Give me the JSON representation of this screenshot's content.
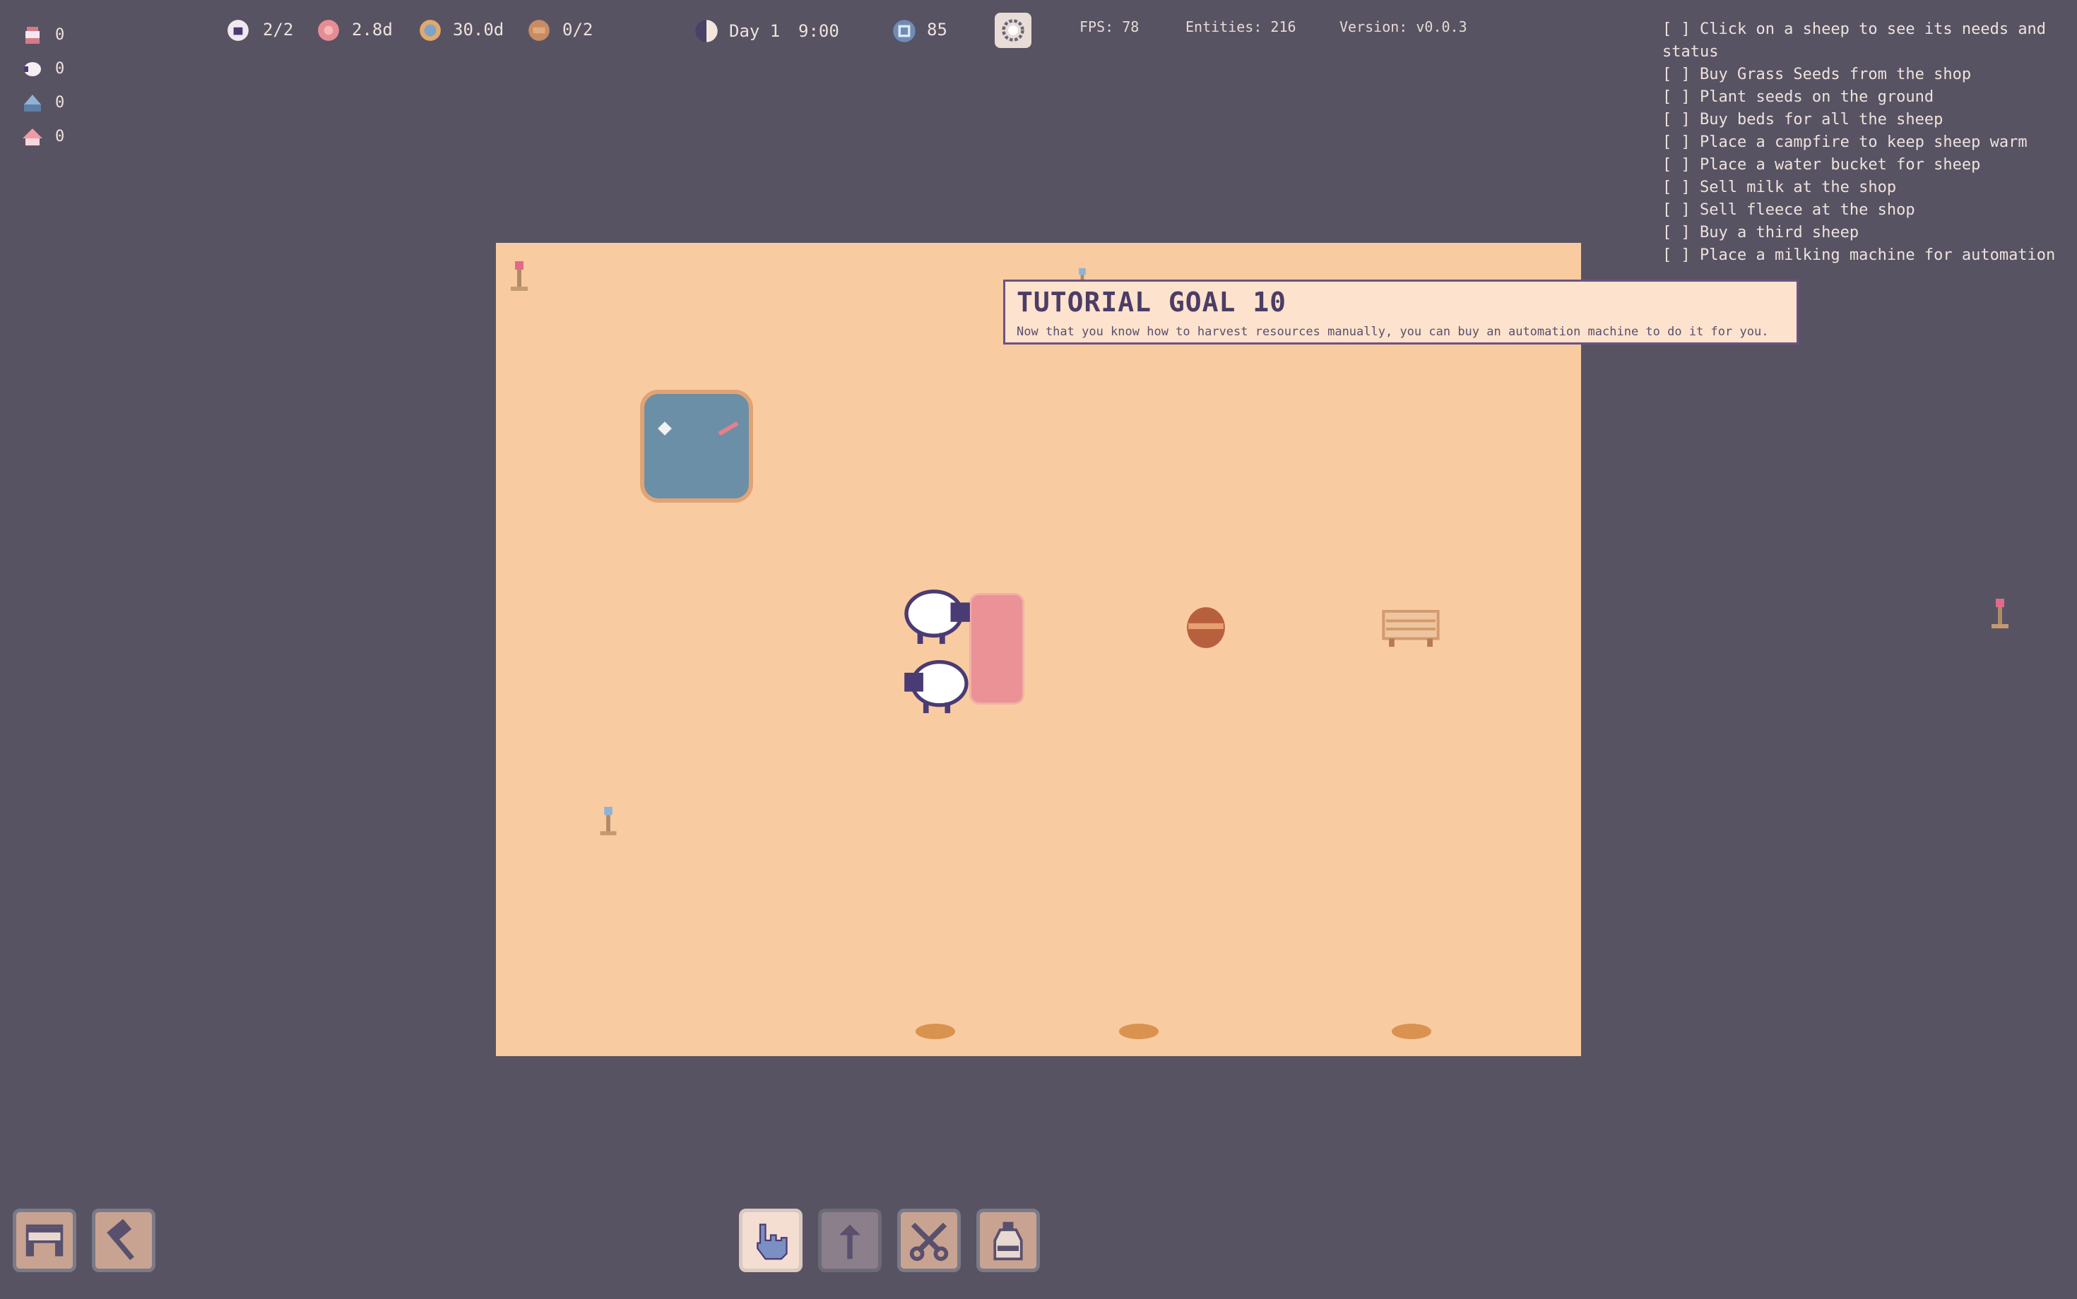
{
  "resources": [
    {
      "icon": "milk-icon",
      "value": "0"
    },
    {
      "icon": "fleece-icon",
      "value": "0"
    },
    {
      "icon": "water-icon",
      "value": "0"
    },
    {
      "icon": "house-icon",
      "value": "0"
    }
  ],
  "hud": {
    "sheep_count": "2/2",
    "food_days": "2.8d",
    "water_days": "30.0d",
    "beds": "0/2",
    "day": "Day 1",
    "time": "9:00",
    "coins": "85",
    "fps": "FPS: 78",
    "entities": "Entities: 216",
    "version": "Version: v0.0.3"
  },
  "tasks": [
    "[ ] Click on a sheep to see its needs and status",
    "[ ] Buy Grass Seeds from the shop",
    "[ ] Plant seeds on the ground",
    "[ ] Buy beds for all the sheep",
    "[ ] Place a campfire to keep sheep warm",
    "[ ] Place a water bucket for sheep",
    "[ ] Sell milk at the shop",
    "[ ] Sell fleece at the shop",
    "[ ] Buy a third sheep",
    "[ ] Place a milking machine for automation"
  ],
  "tooltip": {
    "title": "TUTORIAL GOAL 10",
    "body": "Now that you know how to harvest resources manually, you can buy an automation machine to do it for you."
  },
  "toolbar_left": [
    {
      "icon": "shop-icon"
    },
    {
      "icon": "hammer-icon"
    }
  ],
  "toolbar_tools": [
    {
      "icon": "hand-pointer-icon",
      "state": "active"
    },
    {
      "icon": "shovel-icon",
      "state": "disabled"
    },
    {
      "icon": "scissors-icon",
      "state": "normal"
    },
    {
      "icon": "milk-bottle-icon",
      "state": "normal"
    }
  ],
  "colors": {
    "background": "#575363",
    "field": "#f9cba0",
    "tooltip_bg": "#fde3cd",
    "tooltip_border": "#6b5382",
    "sheep_wool": "#ffffff",
    "sheep_face": "#4a3b74",
    "bed": "#ea9296",
    "pond": "#6b8fa6"
  }
}
